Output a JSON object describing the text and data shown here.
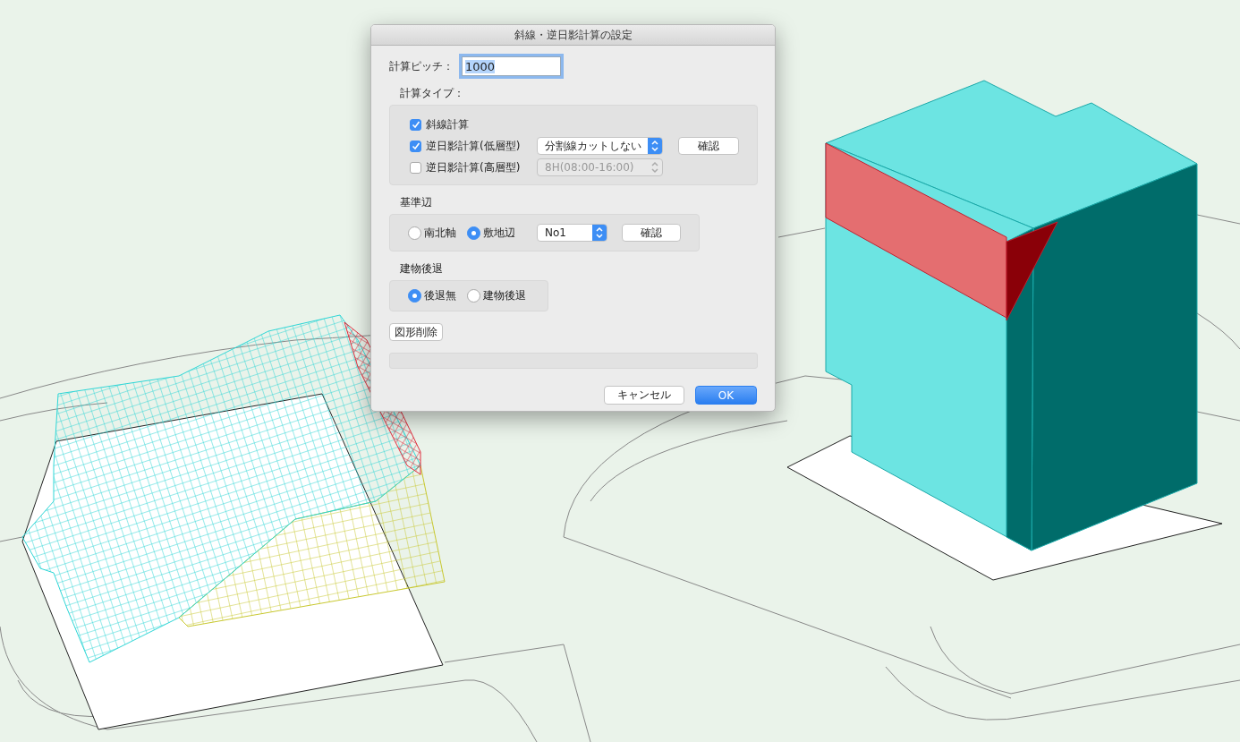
{
  "dialog": {
    "title": "斜線・逆日影計算の設定",
    "pitch": {
      "label": "計算ピッチ：",
      "value": "1000",
      "text_selected": true
    },
    "calc_type": {
      "label": "計算タイプ：",
      "rows": [
        {
          "label": "斜線計算",
          "checked": true
        },
        {
          "label": "逆日影計算(低層型)",
          "checked": true,
          "select": {
            "value": "分割線カットしない",
            "disabled": false
          },
          "button": "確認"
        },
        {
          "label": "逆日影計算(高層型)",
          "checked": false,
          "select": {
            "value": "8H(08:00-16:00)",
            "disabled": true
          }
        }
      ]
    },
    "base_edge": {
      "label": "基準辺",
      "options": [
        {
          "label": "南北軸",
          "selected": false
        },
        {
          "label": "敷地辺",
          "selected": true
        }
      ],
      "select": {
        "value": "No1",
        "disabled": false
      },
      "button": "確認"
    },
    "setback": {
      "label": "建物後退",
      "options": [
        {
          "label": "後退無",
          "selected": true
        },
        {
          "label": "建物後退",
          "selected": false
        }
      ]
    },
    "delete_button": "図形削除",
    "progress": {
      "level": 0
    },
    "buttons": [
      {
        "label": "キャンセル",
        "kind": "normal"
      },
      {
        "label": "OK",
        "kind": "default"
      }
    ]
  }
}
